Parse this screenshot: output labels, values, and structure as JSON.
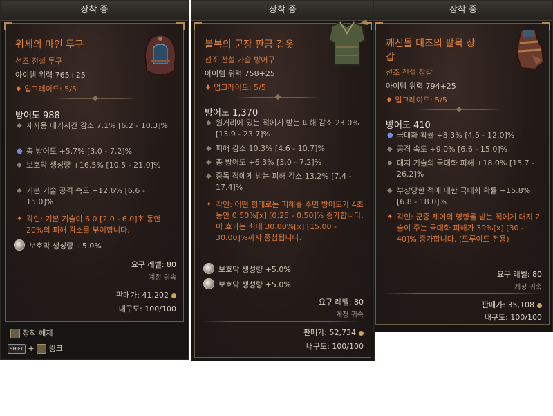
{
  "panels": [
    {
      "header": "장착 중",
      "name_lines": [
        "위세의 마인 투구"
      ],
      "type": "선조 전설 투구",
      "power": "아이템 위력 765+25",
      "upgrade": "업그레이드: 5/5",
      "armor": "방어도 988",
      "stats": [
        {
          "bullet": "diamond",
          "text": "재사용 대기시간 감소 7.1% [6.2 - 10.3]%"
        },
        {
          "bullet": "circle",
          "text": "총 방어도 +5.7% [3.0 - 7.2]%"
        },
        {
          "bullet": "diamond",
          "text": "보호막 생성량 +16.5% [10.5 - 21.0]%"
        },
        {
          "bullet": "diamond",
          "text": "기본 기술 공격 속도 +12.6% [6.6 - 15.0]%"
        }
      ],
      "aspect": "각인: 기본 기술이 6.0 [2.0 - 6.0]초 동안 20%의 피해 감소를 부여합니다.",
      "gems": [
        "보호막 생성량 +5.0%"
      ],
      "required_level": "요구 레벨: 80",
      "bound": "계정 귀속",
      "sell": "판매가: 41,202",
      "durability": "내구도: 100/100",
      "footer": [
        {
          "label": "장착 해제"
        },
        {
          "shift": "SHIFT",
          "plus": "+",
          "label": "링크"
        }
      ],
      "icon": "helmet-icon"
    },
    {
      "header": "장착 중",
      "name_lines": [
        "불복의 군장 판금 갑옷"
      ],
      "type": "선조 전설 가슴 방어구",
      "power": "아이템 위력 758+25",
      "upgrade": "업그레이드: 5/5",
      "armor": "방어도 1,370",
      "stats": [
        {
          "bullet": "diamond",
          "text": "원거리에 있는 적에게 받는 피해 감소 23.0% [13.9 - 23.7]%"
        },
        {
          "bullet": "diamond",
          "text": "피해 감소 10.3% [4.6 - 10.7]%"
        },
        {
          "bullet": "diamond",
          "text": "총 방어도 +6.3% [3.0 - 7.2]%"
        },
        {
          "bullet": "diamond",
          "text": "중독 적에게 받는 피해 감소 13.2% [7.4 - 17.4]%"
        }
      ],
      "aspect": "각인: 어떤 형태로든 피해를 주면 방어도가 4초 동안 0.50%[x] [0.25 - 0.50]% 증가합니다. 이 효과는 최대 30.00%[x] [15.00 - 30.00]%까지 중첩됩니다.",
      "gems": [
        "보호막 생성량 +5.0%",
        "보호막 생성량 +5.0%"
      ],
      "required_level": "요구 레벨: 80",
      "bound": "계정 귀속",
      "sell": "판매가: 52,734",
      "durability": "내구도: 100/100",
      "icon": "chest-armor-icon"
    },
    {
      "header": "장착 중",
      "name_lines": [
        "깨진돌 태초의 팔목 장",
        "갑"
      ],
      "type": "선조 전설 장갑",
      "power": "아이템 위력 794+25",
      "upgrade": "업그레이드: 5/5",
      "armor": "방어도 410",
      "stats": [
        {
          "bullet": "circle",
          "text": "극대화 확률 +8.3% [4.5 - 12.0]%"
        },
        {
          "bullet": "diamond",
          "text": "공격 속도 +9.0% [6.6 - 15.0]%"
        },
        {
          "bullet": "diamond",
          "text": "대지 기술의 극대화 피해 +18.0% [15.7 - 26.2]%"
        },
        {
          "bullet": "diamond",
          "text": "부상당한 적에 대한 극대화 확률 +15.8% [6.8 - 18.0]%"
        }
      ],
      "aspect": "각인: 군중 제어의 영향을 받는 적에게 대지 기술이 주는 극대화 피해가 39%[x] [30 - 40]% 증가합니다. (드루이드 전용)",
      "required_level": "요구 레벨: 80",
      "bound": "계정 귀속",
      "sell": "판매가: 35,108",
      "durability": "내구도: 100/100",
      "icon": "gauntlet-icon"
    }
  ],
  "colors": {
    "legendary": "#e0843c",
    "affix_highlight": "#8fb4ff",
    "background": "#241b18"
  }
}
